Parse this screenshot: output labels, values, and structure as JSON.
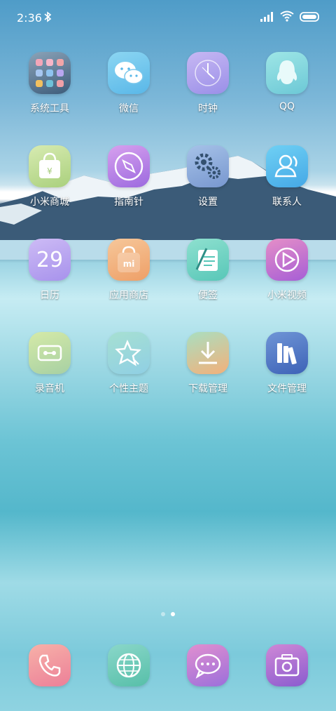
{
  "status": {
    "time": "2:36"
  },
  "apps": [
    {
      "label": "系统工具",
      "icon": "folder-icon"
    },
    {
      "label": "微信",
      "icon": "wechat-icon"
    },
    {
      "label": "时钟",
      "icon": "clock-icon"
    },
    {
      "label": "QQ",
      "icon": "qq-icon"
    },
    {
      "label": "小米商城",
      "icon": "shopping-bag-icon"
    },
    {
      "label": "指南针",
      "icon": "compass-icon"
    },
    {
      "label": "设置",
      "icon": "settings-icon"
    },
    {
      "label": "联系人",
      "icon": "contacts-icon"
    },
    {
      "label": "日历",
      "icon": "calendar-icon",
      "badge": "29"
    },
    {
      "label": "应用商店",
      "icon": "app-store-icon"
    },
    {
      "label": "便签",
      "icon": "notes-icon"
    },
    {
      "label": "小米视频",
      "icon": "video-icon"
    },
    {
      "label": "录音机",
      "icon": "recorder-icon"
    },
    {
      "label": "个性主题",
      "icon": "themes-icon"
    },
    {
      "label": "下载管理",
      "icon": "download-icon"
    },
    {
      "label": "文件管理",
      "icon": "file-manager-icon"
    }
  ],
  "dock": [
    {
      "icon": "phone-icon"
    },
    {
      "icon": "browser-icon"
    },
    {
      "icon": "messages-icon"
    },
    {
      "icon": "camera-icon"
    }
  ],
  "pages": {
    "count": 2,
    "active": 1
  }
}
